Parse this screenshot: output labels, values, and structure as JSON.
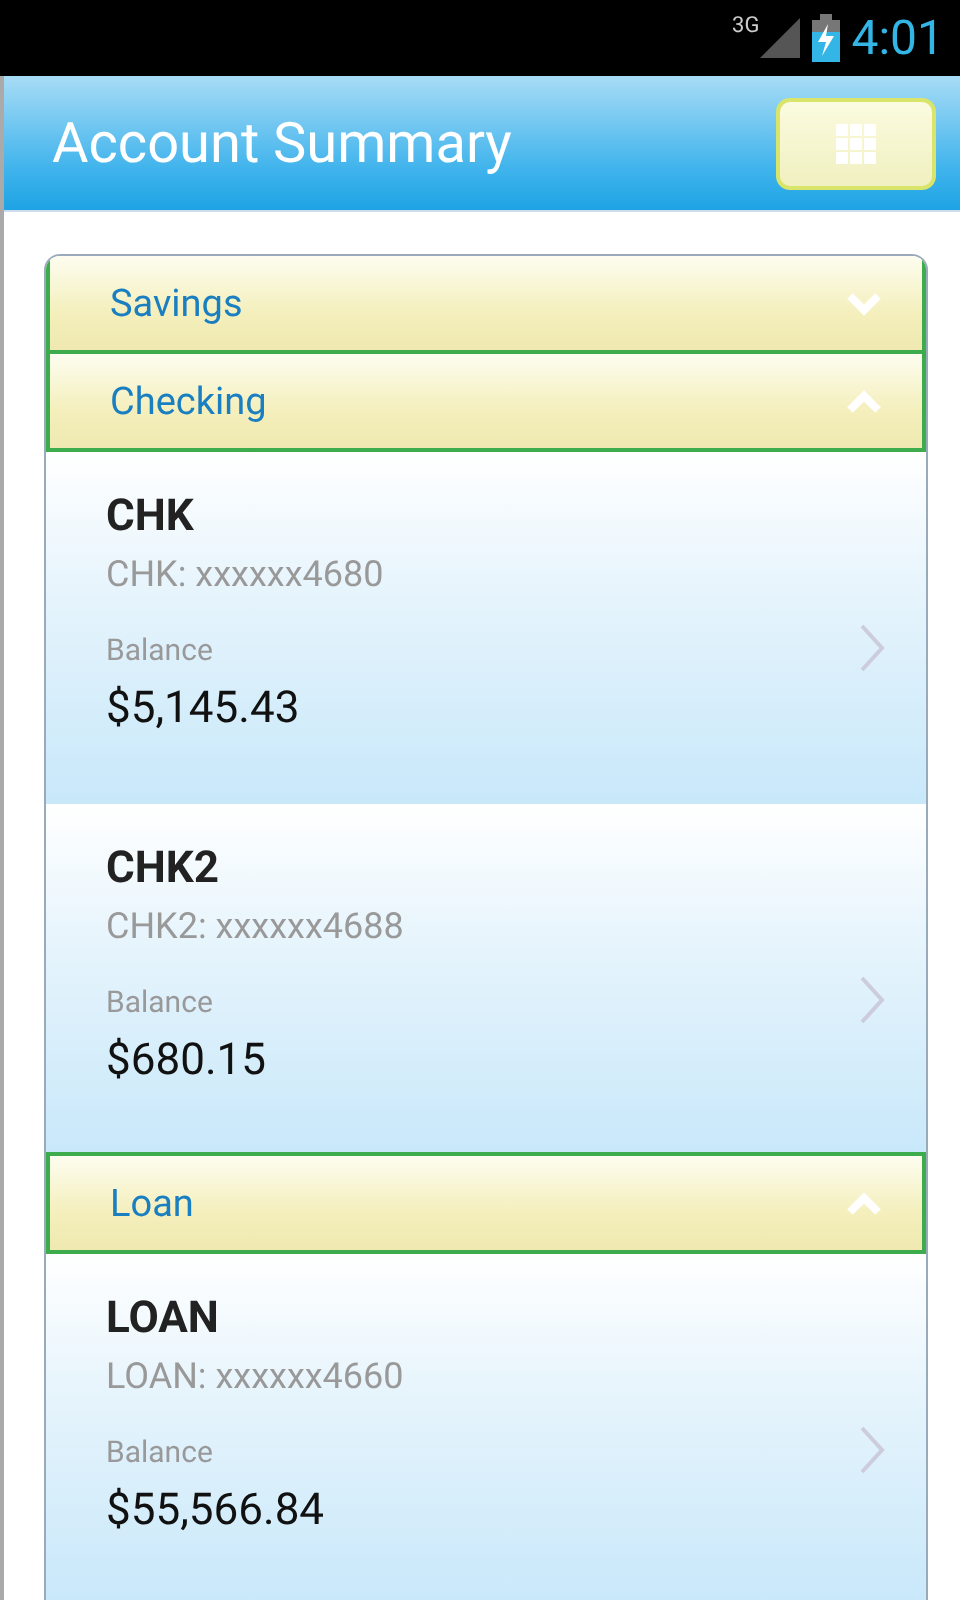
{
  "status_bar": {
    "network": "3G",
    "time": "4:01"
  },
  "header": {
    "title": "Account Summary"
  },
  "sections": [
    {
      "title": "Savings",
      "expanded": false
    },
    {
      "title": "Checking",
      "expanded": true,
      "accounts": [
        {
          "name": "CHK",
          "number": "CHK: xxxxxx4680",
          "balance_label": "Balance",
          "balance": "$5,145.43"
        },
        {
          "name": "CHK2",
          "number": "CHK2: xxxxxx4688",
          "balance_label": "Balance",
          "balance": "$680.15"
        }
      ]
    },
    {
      "title": "Loan",
      "expanded": true,
      "accounts": [
        {
          "name": "LOAN",
          "number": "LOAN: xxxxxx4660",
          "balance_label": "Balance",
          "balance": "$55,566.84"
        }
      ]
    }
  ]
}
